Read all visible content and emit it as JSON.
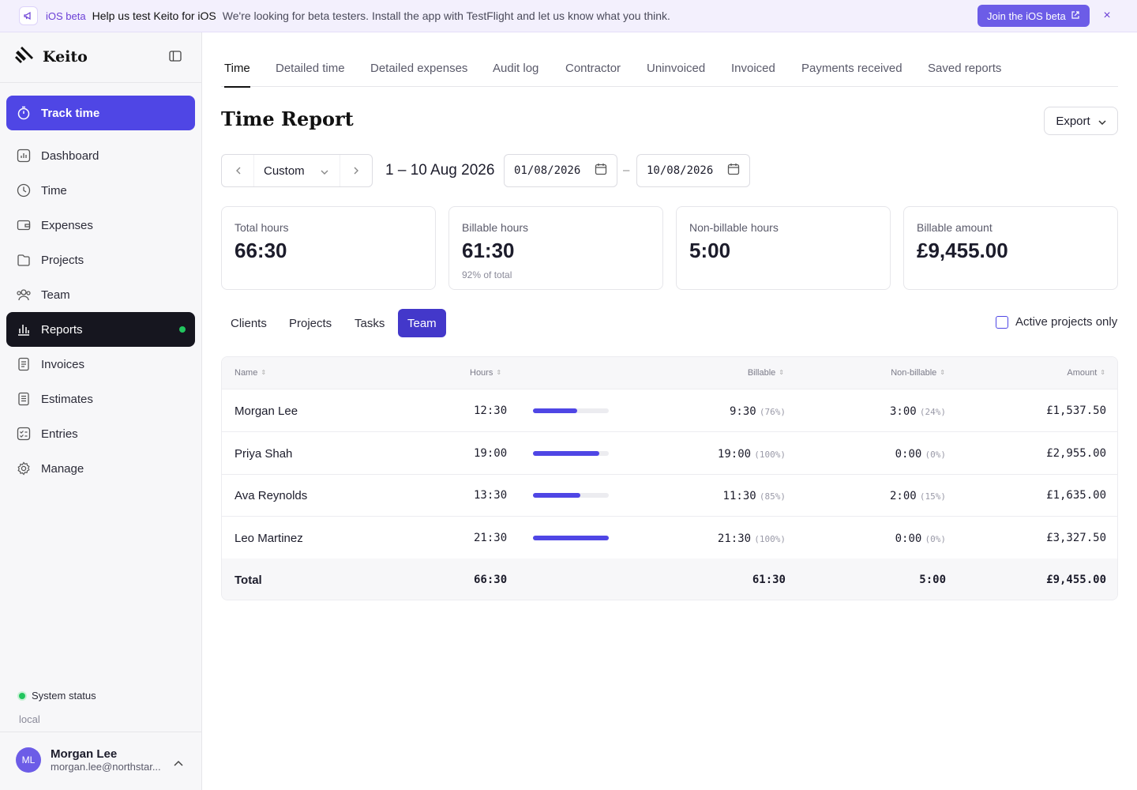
{
  "banner": {
    "tag": "iOS beta",
    "title": "Help us test Keito for iOS",
    "text": "We're looking for beta testers. Install the app with TestFlight and let us know what you think.",
    "button_label": "Join the iOS beta",
    "close_icon": "×"
  },
  "brand": {
    "name": "Keito"
  },
  "sidebar": {
    "items": [
      {
        "label": "Track time",
        "icon": "stopwatch-icon"
      },
      {
        "label": "Dashboard",
        "icon": "dashboard-icon"
      },
      {
        "label": "Time",
        "icon": "clock-icon"
      },
      {
        "label": "Expenses",
        "icon": "wallet-icon"
      },
      {
        "label": "Projects",
        "icon": "folder-icon"
      },
      {
        "label": "Team",
        "icon": "users-icon"
      },
      {
        "label": "Reports",
        "icon": "bar-chart-icon"
      },
      {
        "label": "Invoices",
        "icon": "invoice-icon"
      },
      {
        "label": "Estimates",
        "icon": "estimate-icon"
      },
      {
        "label": "Entries",
        "icon": "checklist-icon"
      },
      {
        "label": "Manage",
        "icon": "gear-icon"
      }
    ],
    "system_status": "System status",
    "environment": "local"
  },
  "user": {
    "initials": "ML",
    "name": "Morgan Lee",
    "email": "morgan.lee@northstar..."
  },
  "tabs": [
    "Time",
    "Detailed time",
    "Detailed expenses",
    "Audit log",
    "Contractor",
    "Uninvoiced",
    "Invoiced",
    "Payments received",
    "Saved reports"
  ],
  "page": {
    "title": "Time Report",
    "export_label": "Export"
  },
  "filters": {
    "period": "Custom",
    "range_text": "1 – 10 Aug 2026",
    "start_date": "01/08/2026",
    "end_date": "10/08/2026",
    "dash": "–"
  },
  "stats": [
    {
      "label": "Total hours",
      "value": "66:30",
      "sub": ""
    },
    {
      "label": "Billable hours",
      "value": "61:30",
      "sub": "92% of total"
    },
    {
      "label": "Non-billable hours",
      "value": "5:00",
      "sub": ""
    },
    {
      "label": "Billable amount",
      "value": "£9,455.00",
      "sub": ""
    }
  ],
  "subtabs": [
    "Clients",
    "Projects",
    "Tasks",
    "Team"
  ],
  "active_only_label": "Active projects only",
  "table": {
    "headers": {
      "name": "Name",
      "hours": "Hours",
      "billable": "Billable",
      "nonbillable": "Non-billable",
      "amount": "Amount"
    },
    "rows": [
      {
        "name": "Morgan Lee",
        "hours": "12:30",
        "bar": 0.58,
        "billable": "9:30",
        "billable_pct": "(76%)",
        "nonbillable": "3:00",
        "nonbillable_pct": "(24%)",
        "amount": "£1,537.50"
      },
      {
        "name": "Priya Shah",
        "hours": "19:00",
        "bar": 0.88,
        "billable": "19:00",
        "billable_pct": "(100%)",
        "nonbillable": "0:00",
        "nonbillable_pct": "(0%)",
        "amount": "£2,955.00"
      },
      {
        "name": "Ava Reynolds",
        "hours": "13:30",
        "bar": 0.63,
        "billable": "11:30",
        "billable_pct": "(85%)",
        "nonbillable": "2:00",
        "nonbillable_pct": "(15%)",
        "amount": "£1,635.00"
      },
      {
        "name": "Leo Martinez",
        "hours": "21:30",
        "bar": 1.0,
        "billable": "21:30",
        "billable_pct": "(100%)",
        "nonbillable": "0:00",
        "nonbillable_pct": "(0%)",
        "amount": "£3,327.50"
      }
    ],
    "total": {
      "label": "Total",
      "hours": "66:30",
      "billable": "61:30",
      "nonbillable": "5:00",
      "amount": "£9,455.00"
    }
  },
  "colors": {
    "accent": "#4f46e5",
    "active_nav": "#16161f",
    "status_green": "#22c55e",
    "banner_bg": "#f3f0fd"
  }
}
